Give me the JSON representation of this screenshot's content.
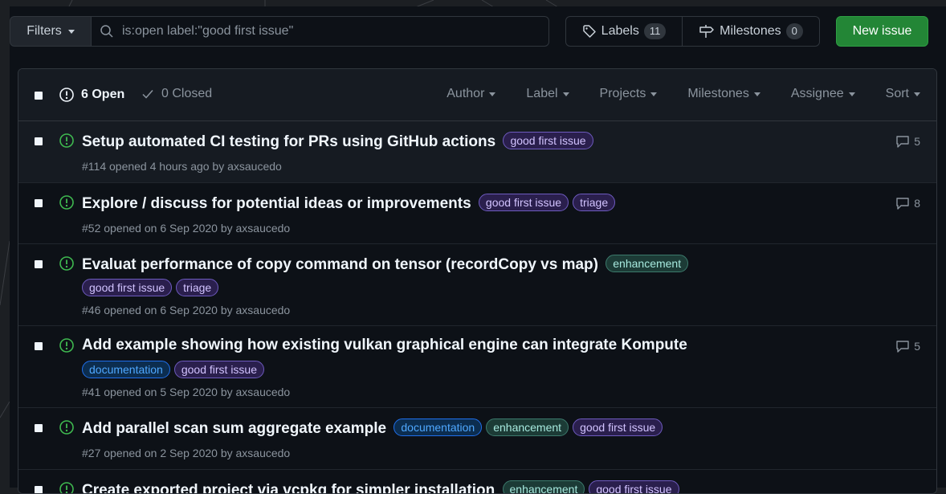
{
  "filters": {
    "label": "Filters"
  },
  "search": {
    "value": "is:open label:\"good first issue\""
  },
  "labels_btn": {
    "label": "Labels",
    "count": "11"
  },
  "milestones_btn": {
    "label": "Milestones",
    "count": "0"
  },
  "new_issue": {
    "label": "New issue"
  },
  "header": {
    "open": "6 Open",
    "closed": "0 Closed",
    "filters": [
      "Author",
      "Label",
      "Projects",
      "Milestones",
      "Assignee",
      "Sort"
    ]
  },
  "colors": {
    "open_icon": "#3fb950",
    "new_issue_bg": "#238636",
    "label_good_first_issue": "#7057ff",
    "label_enhancement": "#a2eeef",
    "label_documentation": "#0075ca"
  },
  "issues": [
    {
      "title": "Setup automated CI testing for PRs using GitHub actions",
      "labels": [
        "good first issue"
      ],
      "meta": "#114 opened 4 hours ago by axsaucedo",
      "comments": "5"
    },
    {
      "title": "Explore / discuss for potential ideas or improvements",
      "labels": [
        "good first issue",
        "triage"
      ],
      "meta": "#52 opened on 6 Sep 2020 by axsaucedo",
      "comments": "8"
    },
    {
      "title": "Evaluat performance of copy command on tensor (recordCopy vs map)",
      "labels": [
        "enhancement",
        "good first issue",
        "triage"
      ],
      "meta": "#46 opened on 6 Sep 2020 by axsaucedo",
      "comments": ""
    },
    {
      "title": "Add example showing how existing vulkan graphical engine can integrate Kompute",
      "labels": [
        "documentation",
        "good first issue"
      ],
      "meta": "#41 opened on 5 Sep 2020 by axsaucedo",
      "comments": "5"
    },
    {
      "title": "Add parallel scan sum aggregate example",
      "labels": [
        "documentation",
        "enhancement",
        "good first issue"
      ],
      "meta": "#27 opened on 2 Sep 2020 by axsaucedo",
      "comments": ""
    },
    {
      "title": "Create exported project via vcpkg for simpler installation",
      "labels": [
        "enhancement",
        "good first issue"
      ],
      "meta": "",
      "comments": ""
    }
  ]
}
